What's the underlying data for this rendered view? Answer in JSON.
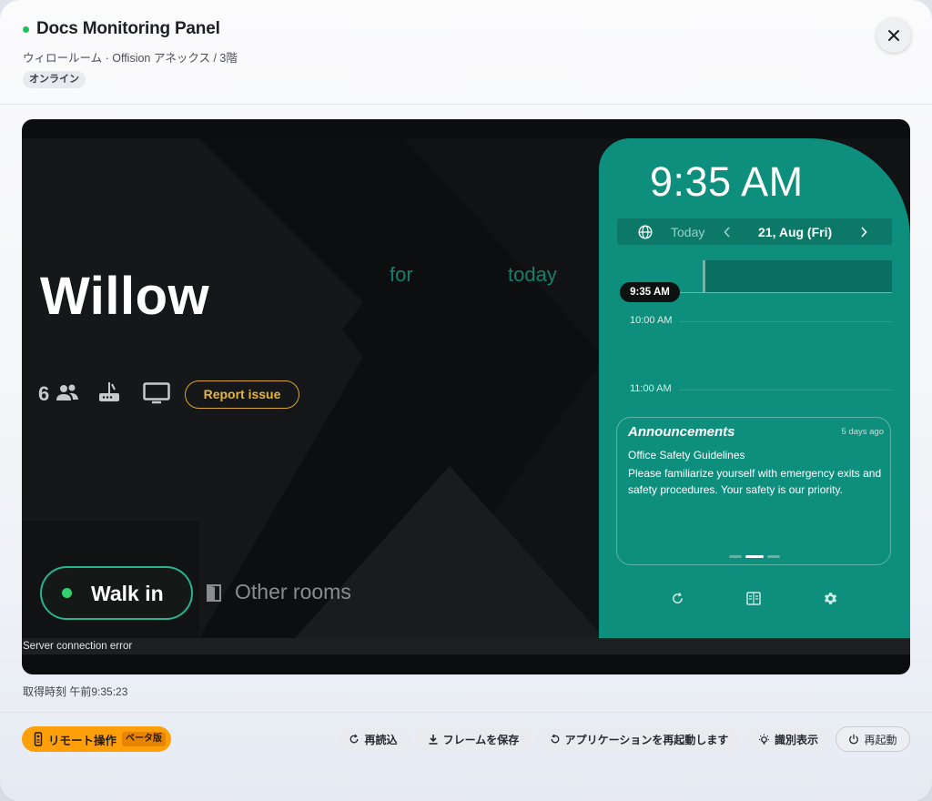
{
  "header": {
    "title": "Docs Monitoring Panel",
    "subtitle": "ウィロールーム · Offision アネックス / 3階",
    "status_badge": "オンライン",
    "status_color": "#1fbf5a"
  },
  "screen": {
    "ghost_text": [
      "for",
      "today"
    ],
    "room_name": "Willow",
    "capacity": "6",
    "report_issue": "Report issue",
    "walk_in": "Walk in",
    "other_rooms": "Other rooms",
    "connection_error": "Server connection error",
    "panel": {
      "clock": "9:35 AM",
      "date_today": "Today",
      "date_value": "21, Aug (Fri)",
      "now_pill": "9:35 AM",
      "hours": [
        "10:00 AM",
        "11:00 AM"
      ],
      "announcements": {
        "title": "Announcements",
        "when": "5 days ago",
        "heading": "Office Safety Guidelines",
        "body": "Please familiarize yourself with emergency exits and safety procedures. Your safety is our priority."
      },
      "accent_color": "#0e8e7c"
    }
  },
  "captured_at": "取得時刻 午前9:35:23",
  "footer": {
    "remote": {
      "label": "リモート操作",
      "beta": "ベータ版"
    },
    "reload": "再読込",
    "save_frame": "フレームを保存",
    "restart_app": "アプリケーションを再起動します",
    "identify": "識別表示",
    "reboot": "再起動"
  }
}
